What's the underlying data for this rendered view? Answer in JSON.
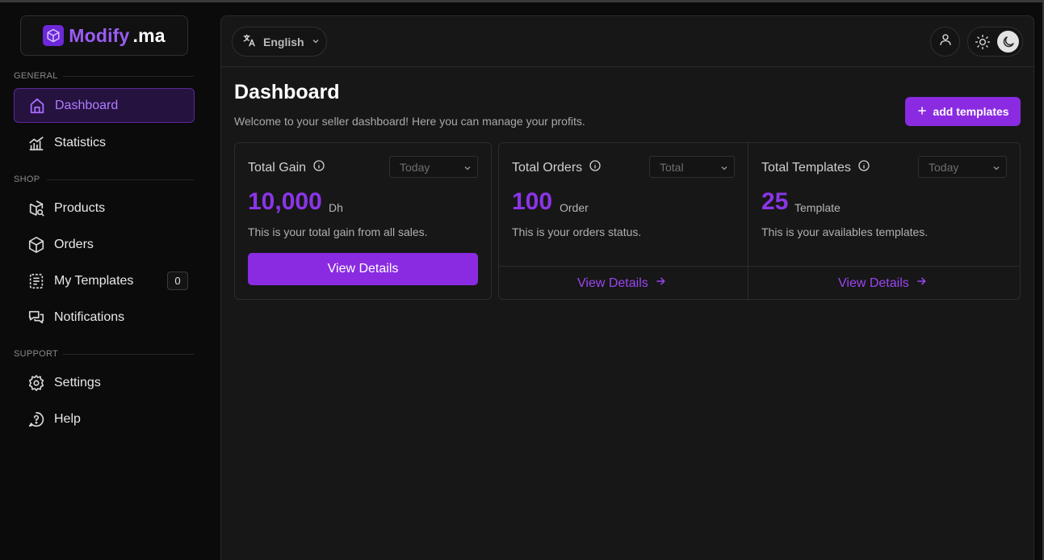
{
  "brand": {
    "name_part1": "Modify",
    "name_part2": ".ma"
  },
  "sidebar": {
    "sections": {
      "general": "GENERAL",
      "shop": "SHOP",
      "support": "SUPPORT"
    },
    "items": [
      {
        "label": "Dashboard",
        "icon": "home-icon",
        "active": true
      },
      {
        "label": "Statistics",
        "icon": "chart-icon"
      },
      {
        "label": "Products",
        "icon": "box-search-icon"
      },
      {
        "label": "Orders",
        "icon": "cube-icon"
      },
      {
        "label": "My Templates",
        "icon": "template-icon",
        "badge": "0"
      },
      {
        "label": "Notifications",
        "icon": "chat-bubbles-icon"
      },
      {
        "label": "Settings",
        "icon": "gear-icon"
      },
      {
        "label": "Help",
        "icon": "help-bubble-icon"
      }
    ]
  },
  "topbar": {
    "language": "English"
  },
  "page": {
    "title": "Dashboard",
    "subtitle": "Welcome to your seller dashboard! Here you can manage your profits.",
    "add_button": "add templates"
  },
  "cards": {
    "gain": {
      "title": "Total Gain",
      "select": "Today",
      "value": "10,000",
      "unit": "Dh",
      "description": "This is your total gain from all sales.",
      "button": "View Details"
    },
    "orders": {
      "title": "Total Orders",
      "select": "Total",
      "value": "100",
      "unit": "Order",
      "description": "This is your orders status.",
      "link": "View Details"
    },
    "templates": {
      "title": "Total Templates",
      "select": "Today",
      "value": "25",
      "unit": "Template",
      "description": "This is your availables templates.",
      "link": "View Details"
    }
  },
  "colors": {
    "accent": "#8a2be2",
    "accent_text": "#8b35e8",
    "background": "#0b0b0b",
    "panel": "#171717"
  }
}
